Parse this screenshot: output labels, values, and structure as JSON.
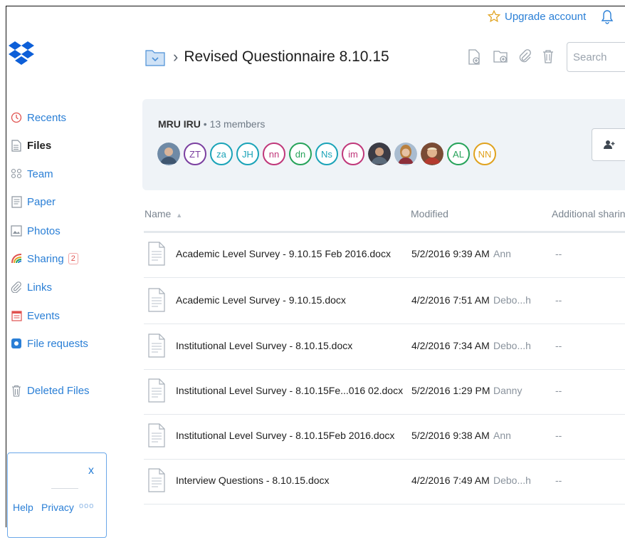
{
  "topbar": {
    "upgrade_label": "Upgrade account",
    "star_icon": "star-icon",
    "bell_icon": "bell-icon"
  },
  "logo": {
    "icon": "dropbox-logo-icon",
    "color": "#0d5fd8"
  },
  "header": {
    "folder_icon": "folder-icon",
    "breadcrumb_separator": "›",
    "title": "Revised Questionnaire 8.10.15",
    "actions": [
      "new-file-icon",
      "new-folder-icon",
      "attach-icon",
      "trash-icon"
    ],
    "search_placeholder": "Search"
  },
  "sidebar": {
    "items": [
      {
        "label": "Recents",
        "icon": "clock-icon",
        "active": false
      },
      {
        "label": "Files",
        "icon": "file-icon",
        "active": true
      },
      {
        "label": "Team",
        "icon": "team-icon",
        "active": false
      },
      {
        "label": "Paper",
        "icon": "paper-icon",
        "active": false
      },
      {
        "label": "Photos",
        "icon": "photos-icon",
        "active": false
      },
      {
        "label": "Sharing",
        "icon": "sharing-icon",
        "active": false,
        "badge": "2"
      },
      {
        "label": "Links",
        "icon": "link-icon",
        "active": false
      },
      {
        "label": "Events",
        "icon": "calendar-icon",
        "active": false
      },
      {
        "label": "File requests",
        "icon": "file-request-icon",
        "active": false
      },
      {
        "label": "Deleted Files",
        "icon": "trash-icon",
        "active": false
      }
    ]
  },
  "footer": {
    "close": "x",
    "help": "Help",
    "privacy": "Privacy",
    "more": "ooo"
  },
  "team": {
    "name": "MRU IRU",
    "separator": "•",
    "members_text": "13 members",
    "members": [
      {
        "type": "photo",
        "icon": "member-photo-1"
      },
      {
        "type": "initials",
        "text": "ZT",
        "color": "#7b3fa0"
      },
      {
        "type": "initials",
        "text": "za",
        "color": "#1aa3b8"
      },
      {
        "type": "initials",
        "text": "JH",
        "color": "#1aa3b8"
      },
      {
        "type": "initials",
        "text": "nn",
        "color": "#c0377a"
      },
      {
        "type": "initials",
        "text": "dn",
        "color": "#27a35a"
      },
      {
        "type": "initials",
        "text": "Ns",
        "color": "#1aa3b8"
      },
      {
        "type": "initials",
        "text": "im",
        "color": "#c0377a"
      },
      {
        "type": "photo",
        "icon": "member-photo-2"
      },
      {
        "type": "photo",
        "icon": "member-photo-3"
      },
      {
        "type": "photo",
        "icon": "member-photo-4"
      },
      {
        "type": "initials",
        "text": "AL",
        "color": "#27a35a"
      },
      {
        "type": "initials",
        "text": "NN",
        "color": "#e0a21e"
      }
    ],
    "add_member_icon": "add-member-icon"
  },
  "table": {
    "headers": {
      "name": "Name",
      "sort_arrow": "▲",
      "modified": "Modified",
      "sharing": "Additional sharing"
    },
    "rows": [
      {
        "name": "Academic Level Survey - 9.10.15 Feb 2016.docx",
        "modified": "5/2/2016 9:39 AM",
        "by": "Ann",
        "sharing": "--"
      },
      {
        "name": "Academic Level Survey - 9.10.15.docx",
        "modified": "4/2/2016 7:51 AM",
        "by": "Debo...h",
        "sharing": "--"
      },
      {
        "name": "Institutional Level Survey - 8.10.15.docx",
        "modified": "4/2/2016 7:34 AM",
        "by": "Debo...h",
        "sharing": "--"
      },
      {
        "name": "Institutional Level Survey - 8.10.15Fe...016 02.docx",
        "modified": "5/2/2016 1:29 PM",
        "by": "Danny",
        "sharing": "--"
      },
      {
        "name": "Institutional Level Survey - 8.10.15Feb 2016.docx",
        "modified": "5/2/2016 9:38 AM",
        "by": "Ann",
        "sharing": "--"
      },
      {
        "name": "Interview Questions - 8.10.15.docx",
        "modified": "4/2/2016 7:49 AM",
        "by": "Debo...h",
        "sharing": "--"
      }
    ]
  }
}
